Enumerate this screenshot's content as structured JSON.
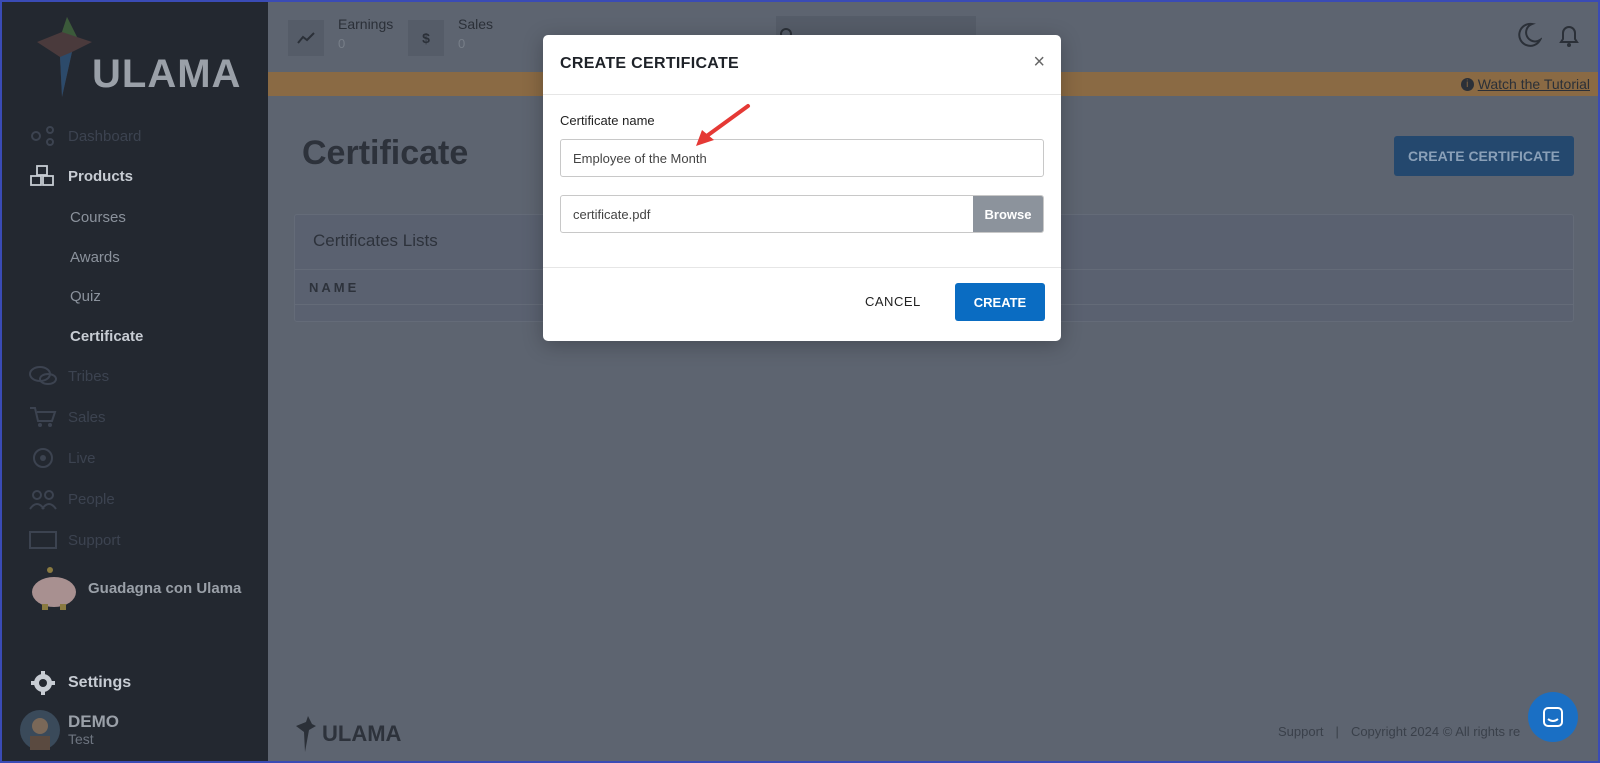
{
  "brand": {
    "logo_text": "ULAMA",
    "accent": "#0a6cc2"
  },
  "sidebar": {
    "items": [
      {
        "label": "Dashboard",
        "icon": "dashboard-icon"
      },
      {
        "label": "Products",
        "icon": "cubes-icon"
      },
      {
        "label": "Tribes",
        "icon": "chat-bubbles-icon"
      },
      {
        "label": "Sales",
        "icon": "cart-icon"
      },
      {
        "label": "Live",
        "icon": "live-icon"
      },
      {
        "label": "People",
        "icon": "people-icon"
      },
      {
        "label": "Support",
        "icon": "support-icon"
      }
    ],
    "subitems": [
      "Courses",
      "Awards",
      "Quiz",
      "Certificate"
    ],
    "earn_label": "Guadagna con Ulama",
    "settings_label": "Settings",
    "user": {
      "name": "DEMO",
      "sub": "Test"
    }
  },
  "topbar": {
    "earnings_label": "Earnings",
    "earnings_value": "0",
    "sales_label": "Sales",
    "sales_value": "0",
    "sales_icon": "$"
  },
  "banner": {
    "tutorial": "Watch the Tutorial"
  },
  "page": {
    "title": "Certificate",
    "create_button": "CREATE CERTIFICATE"
  },
  "card": {
    "title": "Certificates Lists",
    "column_name": "NAME"
  },
  "footer": {
    "logo_text": "ULAMA",
    "support": "Support",
    "sep": "|",
    "copyright": "Copyright 2024 © All rights re"
  },
  "modal": {
    "title": "CREATE CERTIFICATE",
    "close": "×",
    "name_label": "Certificate name",
    "name_value": "Employee of the Month",
    "file_name": "certificate.pdf",
    "browse": "Browse",
    "cancel": "CANCEL",
    "create": "CREATE"
  }
}
